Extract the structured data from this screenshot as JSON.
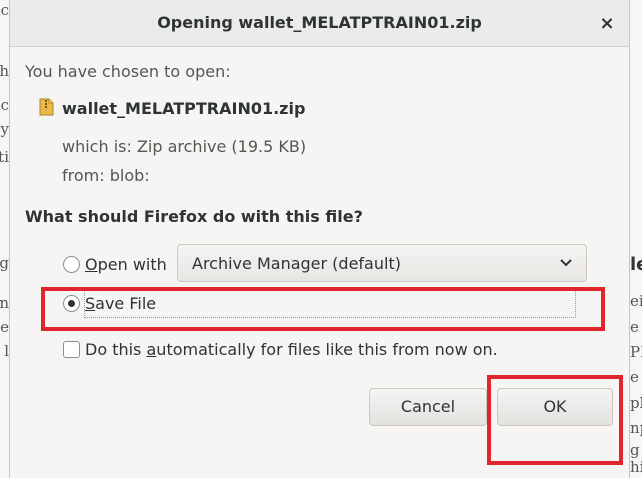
{
  "background": {
    "left_fragments": [
      "ic",
      "th",
      "ic",
      "y",
      "ti",
      "g",
      "n",
      "e",
      "l"
    ],
    "right_fragments": [
      "le",
      "ei",
      "e",
      "PI",
      "e",
      "pli",
      "np",
      "g",
      "hi"
    ]
  },
  "dialog": {
    "title": "Opening wallet_MELATPTRAIN01.zip",
    "close_glyph": "×",
    "chosen_label": "You have chosen to open:",
    "file_name": "wallet_MELATPTRAIN01.zip",
    "which_is": "which is: Zip archive (19.5 KB)",
    "from": "from: blob:",
    "question": "What should Firefox do with this file?",
    "open_with": {
      "prefix": "",
      "accel": "O",
      "rest": "pen with",
      "selected": false
    },
    "app_select": {
      "value": "Archive Manager (default)"
    },
    "save_file": {
      "accel": "S",
      "rest": "ave File",
      "selected": true
    },
    "auto_checkbox": {
      "before": "Do this ",
      "accel": "a",
      "after": "utomatically for files like this from now on.",
      "checked": false
    },
    "buttons": {
      "cancel": "Cancel",
      "ok": "OK"
    }
  },
  "colors": {
    "highlight": "#e0262d",
    "dialog_bg": "#f6f5f4"
  }
}
